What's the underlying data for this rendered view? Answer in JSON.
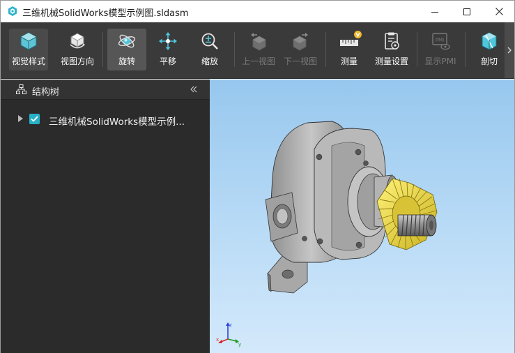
{
  "window": {
    "title": "三维机械SolidWorks模型示例图.sldasm",
    "controls": {
      "minimize": "minimize",
      "maximize": "maximize",
      "close": "close"
    }
  },
  "toolbar": {
    "items": [
      {
        "label": "视觉样式",
        "icon": "visual-style-icon",
        "state": "normal"
      },
      {
        "label": "视图方向",
        "icon": "view-direction-icon",
        "state": "normal"
      },
      {
        "label": "旋转",
        "icon": "rotate-icon",
        "state": "active"
      },
      {
        "label": "平移",
        "icon": "pan-icon",
        "state": "normal"
      },
      {
        "label": "缩放",
        "icon": "zoom-icon",
        "state": "normal"
      },
      {
        "label": "上一视图",
        "icon": "previous-view-icon",
        "state": "disabled"
      },
      {
        "label": "下一视图",
        "icon": "next-view-icon",
        "state": "disabled"
      },
      {
        "label": "测量",
        "icon": "measure-icon",
        "state": "normal",
        "badge": "V"
      },
      {
        "label": "测量设置",
        "icon": "measure-settings-icon",
        "state": "normal"
      },
      {
        "label": "显示PMI",
        "icon": "pmi-icon",
        "state": "disabled",
        "icon_text": "PMI"
      },
      {
        "label": "剖切",
        "icon": "section-icon",
        "state": "normal"
      }
    ]
  },
  "panel": {
    "title": "结构树",
    "tree": [
      {
        "label": "三维机械SolidWorks模型示例...",
        "checked": true,
        "expanded": false
      }
    ]
  },
  "viewport": {
    "model": "gear-pump-assembly",
    "triad_axes": [
      "x",
      "y",
      "z"
    ]
  },
  "colors": {
    "accent": "#27b0c8",
    "toolbar_bg": "#3a3a3a",
    "panel_bg": "#2b2b2b",
    "gear": "#e8d53c",
    "housing": "#9c9c9c"
  }
}
